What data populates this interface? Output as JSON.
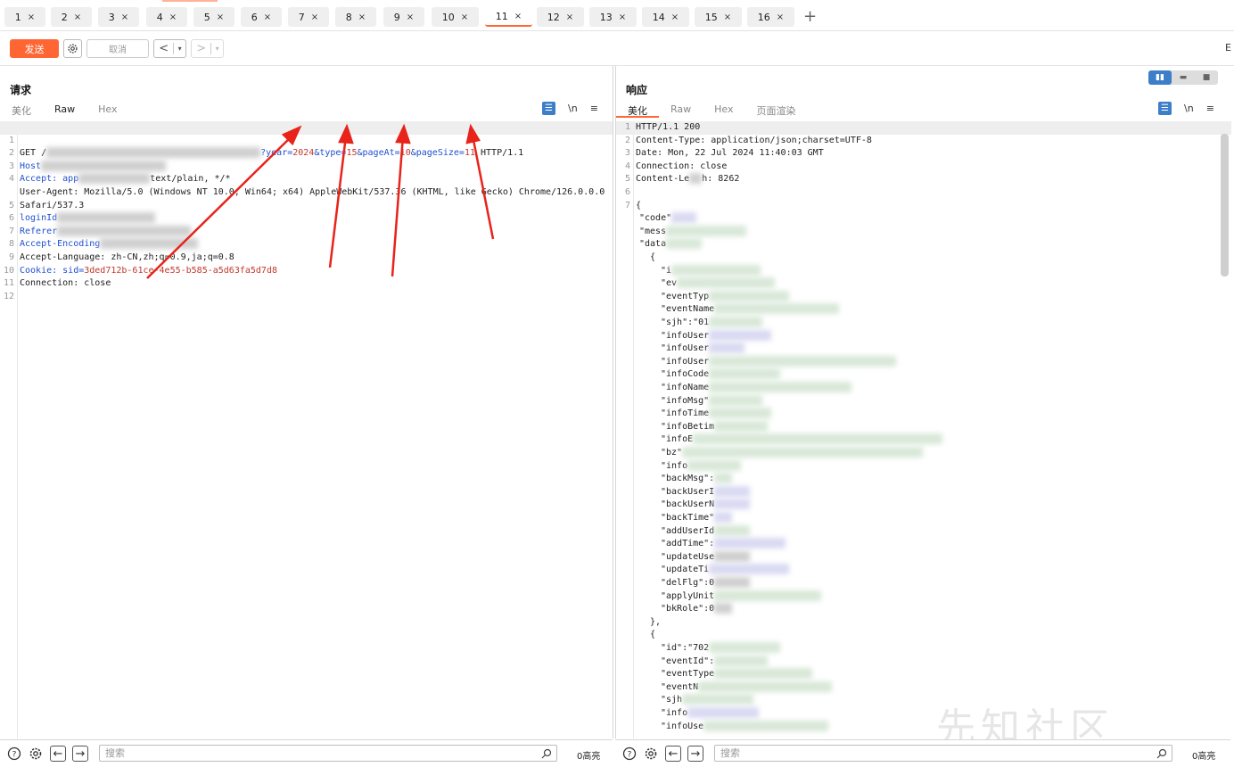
{
  "tabs": [
    {
      "label": "1"
    },
    {
      "label": "2"
    },
    {
      "label": "3"
    },
    {
      "label": "4"
    },
    {
      "label": "5"
    },
    {
      "label": "6"
    },
    {
      "label": "7"
    },
    {
      "label": "8"
    },
    {
      "label": "9"
    },
    {
      "label": "10"
    },
    {
      "label": "11"
    },
    {
      "label": "12"
    },
    {
      "label": "13"
    },
    {
      "label": "14"
    },
    {
      "label": "15"
    },
    {
      "label": "16"
    }
  ],
  "tab_close": "×",
  "add_tab": "+",
  "active_tab": "11",
  "toolbar": {
    "send_label": "发送",
    "cancel_label": "取消",
    "right_char": "E"
  },
  "request": {
    "title": "请求",
    "subtabs": [
      "美化",
      "Raw",
      "Hex"
    ],
    "selected_subtab": "Raw",
    "lines": {
      "l1_method": "GET /",
      "l1_q1k": "?year=",
      "l1_q1v": "2024",
      "l1_q2k": "&type=",
      "l1_q2v": "15",
      "l1_q3k": "&pageAt=",
      "l1_q3v": "10",
      "l1_q4k": "&pageSize=",
      "l1_q4v": "11",
      "l1_proto": " HTTP/1.1",
      "l2": "Host",
      "l3a": "Accept: app",
      "l3b": "text/plain, */*",
      "l4a": "User-Agent: Mozilla/5.0 (Windows NT 10.0; Win64; x64) AppleWebKit/537.36 (KHTML, like Gecko) Chrome/126.0.0.0",
      "l4b": "Safari/537.3",
      "l5": "loginId",
      "l6": "Referer",
      "l7": "Accept-Encoding",
      "l8": "Accept-Language: zh-CN,zh;q=0.9,ja;q=0.8",
      "l9k": "Cookie: sid=",
      "l9v": "3ded712b-61ce-4e55-b585-a5d63fa5d7d8",
      "l10": "Connection: close"
    },
    "line_numbers": [
      "1",
      "2",
      "3",
      "4",
      "",
      "5",
      "6",
      "7",
      "8",
      "9",
      "10",
      "11",
      "12"
    ]
  },
  "response": {
    "title": "响应",
    "subtabs": [
      "美化",
      "Raw",
      "Hex",
      "页面渲染"
    ],
    "selected_subtab": "美化",
    "headers": {
      "h1": "HTTP/1.1 200",
      "h2": "Content-Type: application/json;charset=UTF-8",
      "h3": "Date: Mon, 22 Jul 2024 11:40:03 GMT",
      "h4": "Connection: close",
      "h5": "Content-Le",
      "h5b": "h: 8262"
    },
    "line_numbers": [
      "1",
      "2",
      "3",
      "4",
      "5",
      "6",
      "7"
    ],
    "json_keys": {
      "open": "{",
      "code": "\"code\"",
      "mess": "\"mess",
      "data": "\"data",
      "obj_open": "{",
      "k_i": "\"i",
      "k_ev": "\"ev",
      "k_eventType": "\"eventTyp",
      "k_eventName": "\"eventName",
      "k_sjh": "\"sjh\":\"01",
      "k_infoUser1": "\"infoUser",
      "k_infoUser2": "\"infoUser",
      "k_infoUser3": "\"infoUser",
      "k_infoCode": "\"infoCode",
      "k_infoName": "\"infoName",
      "k_infoMsg": "\"infoMsg\"",
      "k_infoTime": "\"infoTime",
      "k_infoBetim": "\"infoBetim",
      "k_infoE": "\"infoE",
      "k_bz": "\"bz\"",
      "k_info": "\"info",
      "k_backMsg": "\"backMsg\":",
      "k_backUserI": "\"backUserI",
      "k_backUserN": "\"backUserN",
      "k_backTime": "\"backTime\"",
      "k_addUserId": "\"addUserId",
      "k_addTime": "\"addTime\":",
      "k_updateUse": "\"updateUse",
      "k_updateTi": "\"updateTi",
      "k_delFlg": "\"delFlg\":0",
      "k_applyUnit": "\"applyUnit",
      "k_bkRole": "\"bkRole\":0",
      "obj_close": "},",
      "obj2_open": "{",
      "k2_id": "\"id\":\"702",
      "k2_eventId": "\"eventId\":",
      "k2_eventType": "\"eventType",
      "k2_eventN": "\"eventN",
      "k2_sjh": "\"sjh",
      "k2_info": "\"info",
      "k2_infoUse": "\"infoUse"
    }
  },
  "searchbar": {
    "placeholder": "搜索",
    "count_label": "0高亮"
  },
  "watermark": "先知社区",
  "colors": {
    "accent": "#ff6633",
    "blue": "#3d7ec9",
    "param_value": "#c0392b",
    "param_key": "#1f4fd1",
    "annotation_arrow": "#e8231a"
  },
  "icons": {
    "gear": "gear-icon",
    "back": "chevron-left-icon",
    "forward": "chevron-right-icon",
    "help": "help-icon",
    "search": "search-icon",
    "wrap": "wrap-icon",
    "newline": "newline-icon",
    "menu": "menu-icon"
  },
  "newline_symbol": "\\n",
  "menu_symbol": "≡"
}
